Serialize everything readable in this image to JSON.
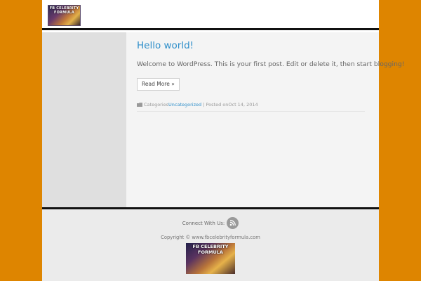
{
  "header": {
    "logo_text": "FB CELEBRITY FORMULA"
  },
  "post": {
    "title": "Hello world!",
    "excerpt": "Welcome to WordPress. This is your first post. Edit or delete it, then start blogging!",
    "read_more_label": "Read More »",
    "categories_label": "Categories",
    "category_link": "Uncategorized",
    "posted_on_label": "Posted on",
    "date": "Oct 14, 2014"
  },
  "footer": {
    "connect_label": "Connect With Us:",
    "copyright": "Copyright © www.fbcelebrityformula.com",
    "logo_text": "FB CELEBRITY FORMULA"
  },
  "icons": {
    "category": "folder-icon",
    "social": "rss-icon"
  },
  "colors": {
    "page_background": "#de8500",
    "link": "#2f8fca",
    "sidebar": "#dfdfdf",
    "content": "#f4f4f4",
    "footer": "#ebebeb",
    "divider": "#111111"
  }
}
